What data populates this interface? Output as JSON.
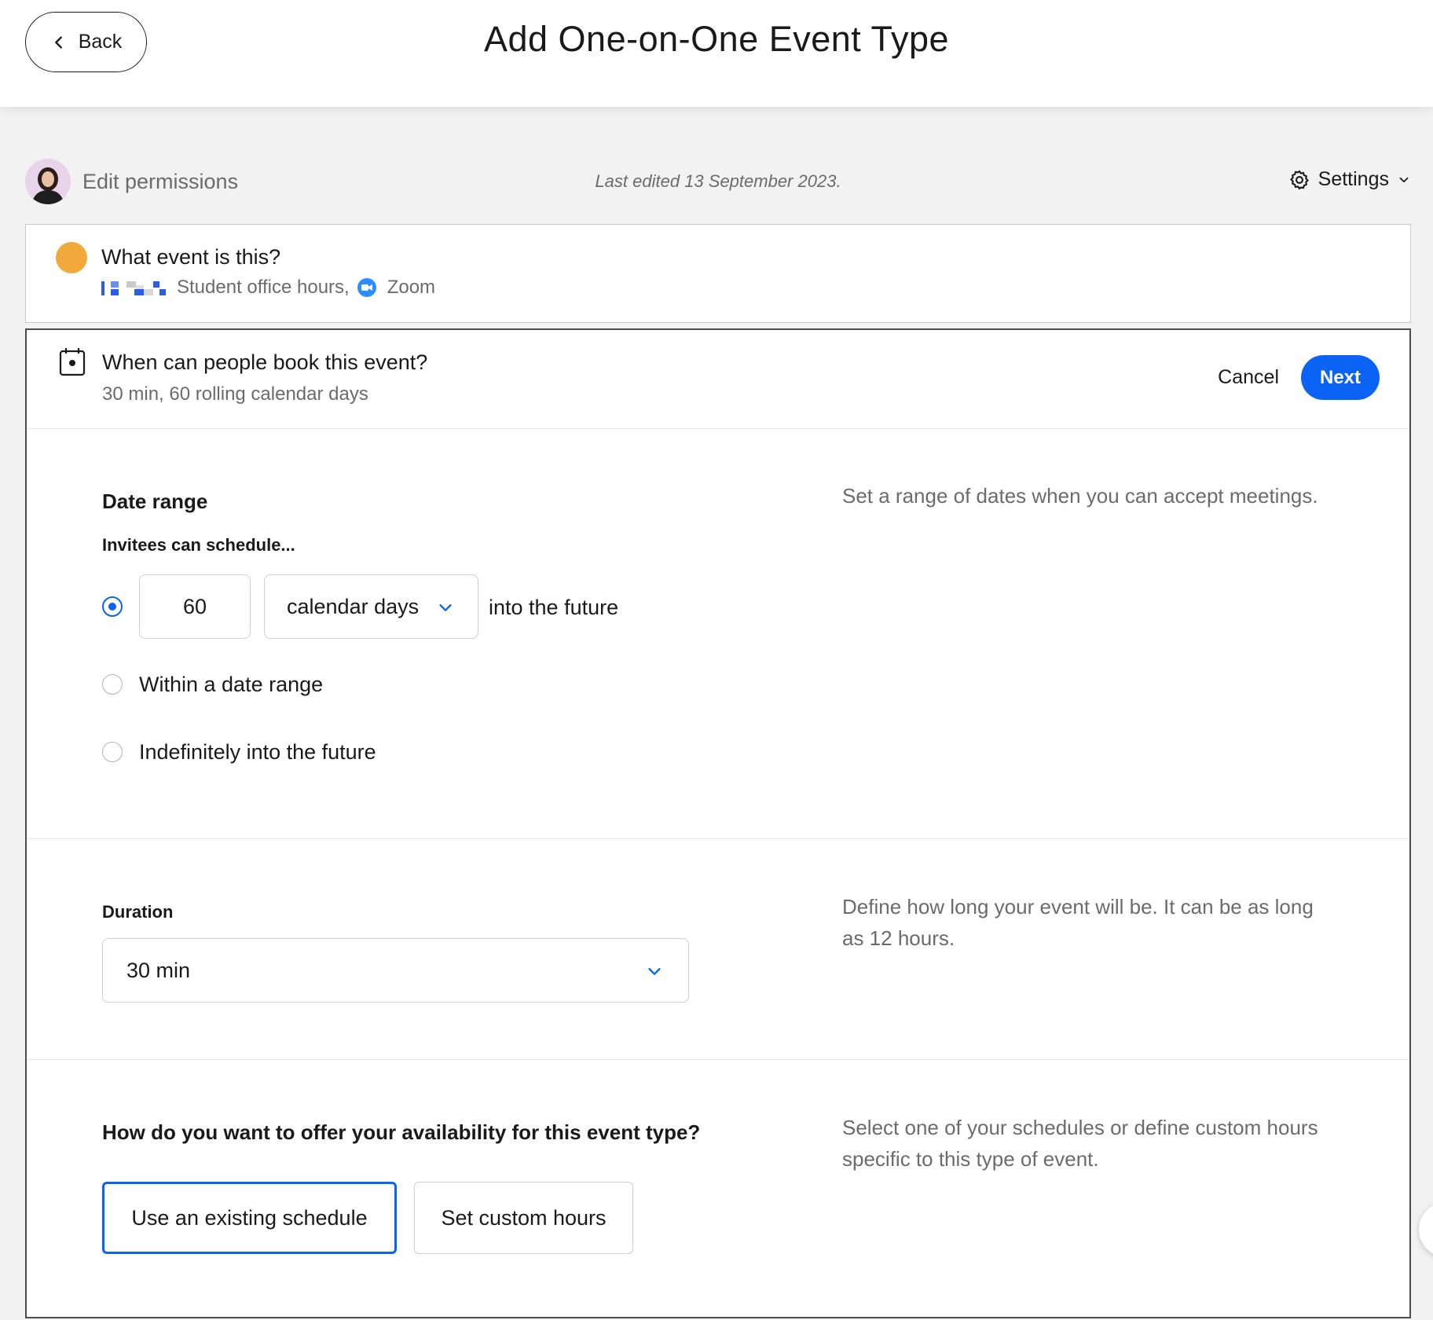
{
  "header": {
    "back_label": "Back",
    "title": "Add One-on-One Event Type"
  },
  "meta": {
    "edit_permissions": "Edit permissions",
    "last_edited": "Last edited 13 September 2023.",
    "settings_label": "Settings"
  },
  "event_card": {
    "title": "What event is this?",
    "subtitle": "Student office hours,",
    "location": "Zoom",
    "color": "#f2a93b"
  },
  "booking_card": {
    "title": "When can people book this event?",
    "subtitle": "30 min, 60 rolling calendar days",
    "cancel_label": "Cancel",
    "next_label": "Next"
  },
  "date_range": {
    "heading": "Date range",
    "help": "Set a range of dates when you can accept meetings.",
    "sub_heading": "Invitees can schedule...",
    "days_value": "60",
    "days_unit": "calendar days",
    "into_future": "into the future",
    "option_within": "Within a date range",
    "option_indefinitely": "Indefinitely into the future",
    "selected_option": "rolling"
  },
  "duration": {
    "heading": "Duration",
    "value": "30 min",
    "help": "Define how long your event will be. It can be as long as 12 hours."
  },
  "availability": {
    "heading": "How do you want to offer your availability for this event type?",
    "help": "Select one of your schedules or define custom hours specific to this type of event.",
    "option_existing": "Use an existing schedule",
    "option_custom": "Set custom hours",
    "selected_option": "existing"
  },
  "colors": {
    "accent": "#0b63f3",
    "zoom": "#2d8cff"
  }
}
